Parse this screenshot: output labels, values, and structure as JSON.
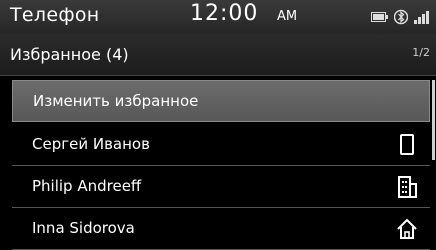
{
  "status": {
    "app_title": "Телефон",
    "time": "12:00",
    "ampm": "AM",
    "icons": [
      "battery-icon",
      "bluetooth-icon",
      "signal-icon"
    ]
  },
  "header": {
    "title": "Избранное (4)",
    "page_indicator": "1/2"
  },
  "list": {
    "items": [
      {
        "label": "Изменить избранное",
        "icon": null
      },
      {
        "label": "Сергей Иванов",
        "icon": "mobile-phone-icon"
      },
      {
        "label": "Philip Andreeff",
        "icon": "office-building-icon"
      },
      {
        "label": "Inna Sidorova",
        "icon": "home-icon"
      }
    ]
  }
}
